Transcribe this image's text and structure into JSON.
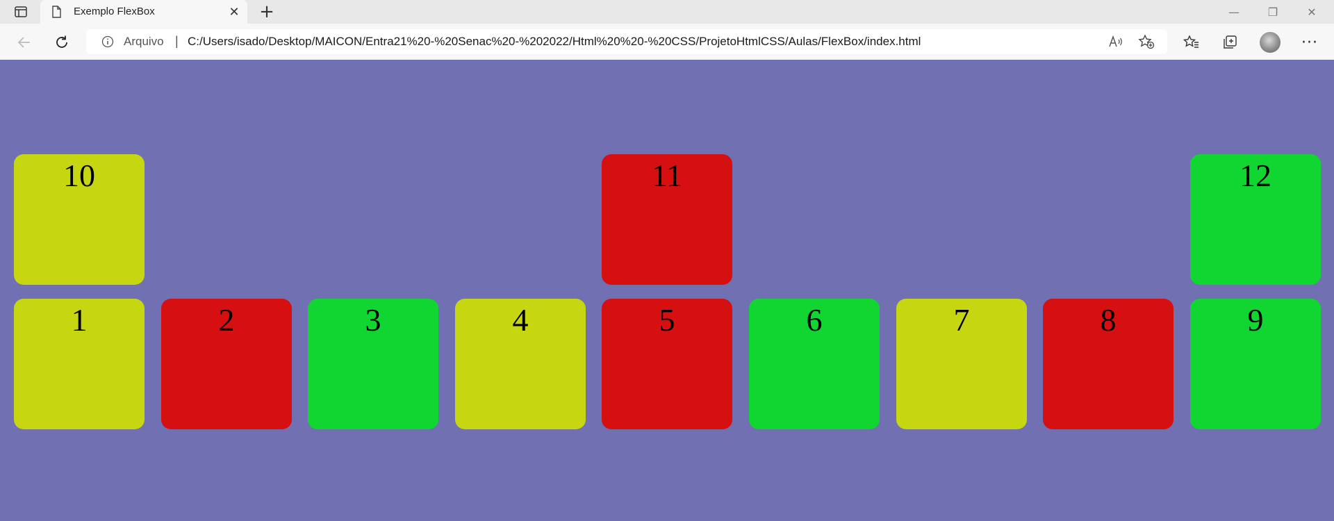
{
  "browser": {
    "tab_title": "Exemplo FlexBox",
    "tab_close": "✕",
    "new_tab": "+",
    "window_minimize": "—",
    "window_restore": "❐",
    "window_close": "✕",
    "site_info_label": "Arquivo",
    "address_separator": "|",
    "url": "C:/Users/isado/Desktop/MAICON/Entra21%20-%20Senac%20-%202022/Html%20%20-%20CSS/ProjetoHtmlCSS/Aulas/FlexBox/index.html",
    "more_menu": "···",
    "icons": {
      "tab_actions": "tab-actions-icon",
      "tab_page": "page-icon",
      "back": "back-arrow-icon",
      "refresh": "refresh-icon",
      "info": "info-icon",
      "read_aloud": "read-aloud-icon",
      "add_favorite": "add-favorite-icon",
      "favorites": "favorites-icon",
      "collections": "collections-icon",
      "profile": "profile-avatar"
    }
  },
  "page": {
    "background": "#7070b2",
    "colors": {
      "yellow": "#c6d611",
      "red": "#d60f11",
      "green": "#11d631"
    },
    "top_row": [
      {
        "label": "10",
        "color": "#c6d611"
      },
      {
        "label": "11",
        "color": "#d60f11"
      },
      {
        "label": "12",
        "color": "#11d631"
      }
    ],
    "bottom_row": [
      {
        "label": "1",
        "color": "#c6d611"
      },
      {
        "label": "2",
        "color": "#d60f11"
      },
      {
        "label": "3",
        "color": "#11d631"
      },
      {
        "label": "4",
        "color": "#c6d611"
      },
      {
        "label": "5",
        "color": "#d60f11"
      },
      {
        "label": "6",
        "color": "#11d631"
      },
      {
        "label": "7",
        "color": "#c6d611"
      },
      {
        "label": "8",
        "color": "#d60f11"
      },
      {
        "label": "9",
        "color": "#11d631"
      }
    ]
  }
}
